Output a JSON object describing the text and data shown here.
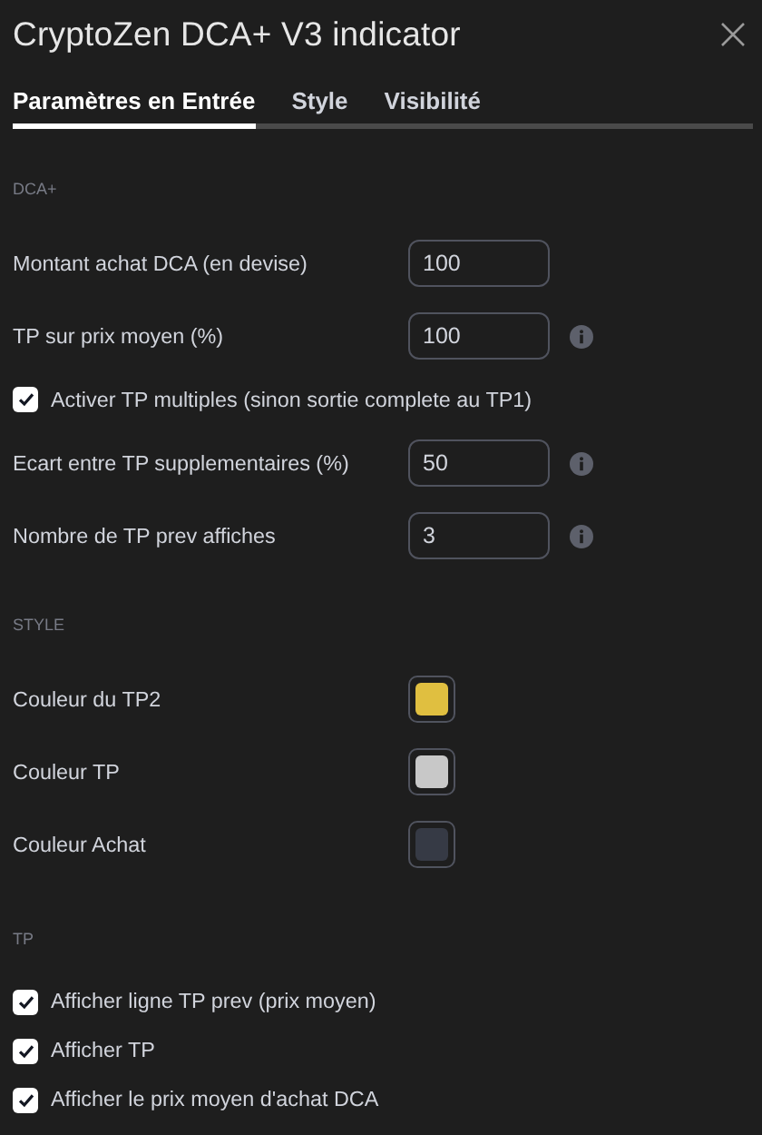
{
  "window": {
    "title": "CryptoZen DCA+ V3 indicator"
  },
  "tabs": [
    {
      "label": "Paramètres en Entrée",
      "selected": true
    },
    {
      "label": "Style",
      "selected": false
    },
    {
      "label": "Visibilité",
      "selected": false
    }
  ],
  "sections": [
    {
      "heading": "DCA+",
      "items": [
        {
          "kind": "number",
          "label": "Montant achat DCA (en devise)",
          "value": "100",
          "info": false
        },
        {
          "kind": "number",
          "label": "TP sur prix moyen (%)",
          "value": "100",
          "info": true
        },
        {
          "kind": "checkbox",
          "label": "Activer TP multiples (sinon sortie complete au TP1)",
          "checked": true
        },
        {
          "kind": "number",
          "label": "Ecart entre TP supplementaires (%)",
          "value": "50",
          "info": true
        },
        {
          "kind": "number",
          "label": "Nombre de TP prev affiches",
          "value": "3",
          "info": true
        }
      ]
    },
    {
      "heading": "STYLE",
      "items": [
        {
          "kind": "color",
          "label": "Couleur du TP2",
          "color": "#e0bf40"
        },
        {
          "kind": "color",
          "label": "Couleur TP",
          "color": "#c8c8c8"
        },
        {
          "kind": "color",
          "label": "Couleur Achat",
          "color": "#363a45"
        }
      ]
    },
    {
      "heading": "TP",
      "items": [
        {
          "kind": "checkbox",
          "label": "Afficher ligne TP prev (prix moyen)",
          "checked": true
        },
        {
          "kind": "checkbox",
          "label": "Afficher TP",
          "checked": true
        },
        {
          "kind": "checkbox",
          "label": "Afficher le prix moyen d'achat DCA",
          "checked": true
        }
      ]
    }
  ]
}
